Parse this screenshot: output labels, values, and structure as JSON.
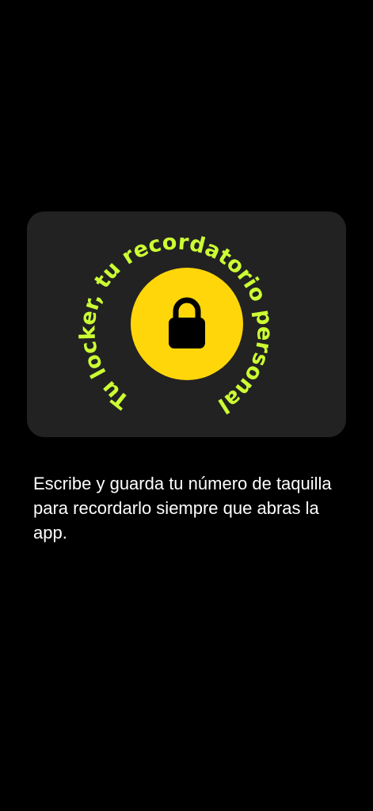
{
  "card": {
    "curved_text": "Tu locker, tu recordatorio personal",
    "icon": "lock-icon",
    "colors": {
      "card_background": "#222222",
      "circle": "#FFD60A",
      "curved_text": "#CCFF33",
      "lock": "#000000"
    }
  },
  "description": {
    "text": "Escribe y guarda tu número de taquilla para recordarlo siempre que abras la app."
  }
}
